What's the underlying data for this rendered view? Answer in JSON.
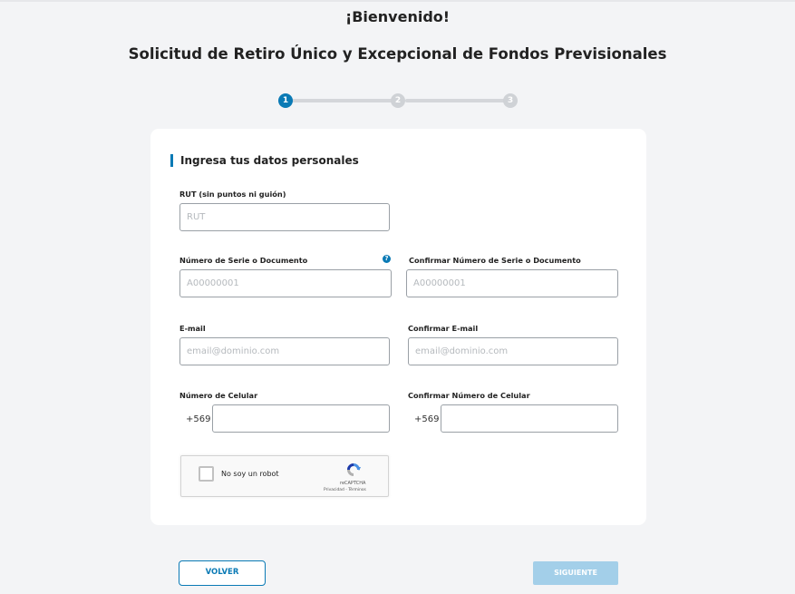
{
  "header": {
    "welcome": "¡Bienvenido!",
    "title": "Solicitud de Retiro Único y Excepcional de Fondos Previsionales"
  },
  "stepper": {
    "steps": [
      "1",
      "2",
      "3"
    ],
    "active_step": 1
  },
  "form": {
    "section_title": "Ingresa tus datos personales",
    "rut": {
      "label": "RUT (sin puntos ni guión)",
      "placeholder": "RUT"
    },
    "serie": {
      "label": "Número de Serie o Documento",
      "placeholder": "A00000001",
      "help_icon": "question-circle-icon"
    },
    "serie_confirm": {
      "label": "Confirmar Número de Serie o Documento",
      "placeholder": "A00000001"
    },
    "email": {
      "label": "E-mail",
      "placeholder": "email@dominio.com"
    },
    "email_confirm": {
      "label": "Confirmar E-mail",
      "placeholder": "email@dominio.com"
    },
    "phone": {
      "label": "Número de Celular",
      "prefix": "+569",
      "value": ""
    },
    "phone_confirm": {
      "label": "Confirmar Número de Celular",
      "prefix": "+569",
      "value": ""
    },
    "recaptcha": {
      "label": "No soy un robot",
      "brand": "reCAPTCHA",
      "privacy": "Privacidad",
      "separator": "-",
      "terms": "Términos"
    }
  },
  "actions": {
    "back_label": "VOLVER",
    "next_label": "SIGUIENTE"
  },
  "colors": {
    "accent": "#0a7ab5",
    "disabled_button": "#a3cfe9",
    "background": "#f3f4f6"
  }
}
